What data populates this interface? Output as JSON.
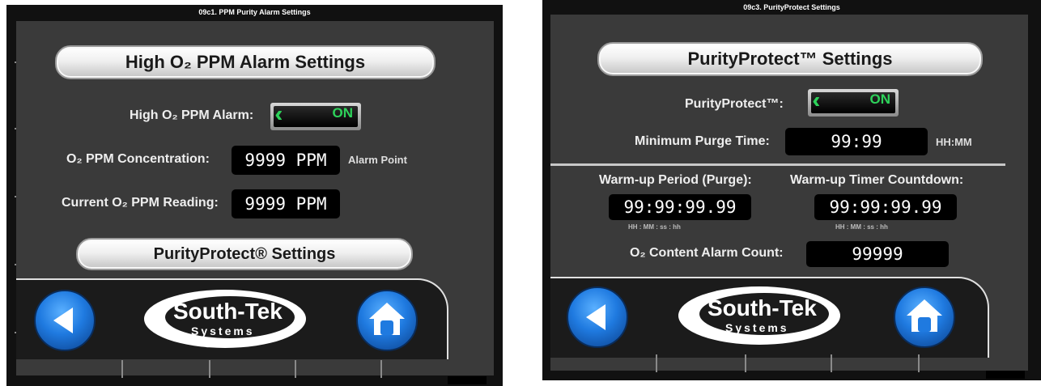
{
  "panel1": {
    "title": "09c1. PPM Purity Alarm Settings",
    "header": "High O₂ PPM Alarm Settings",
    "alarm_label": "High O₂ PPM Alarm:",
    "alarm_state": "ON",
    "concentration_label": "O₂ PPM Concentration:",
    "concentration_value": "9999 PPM",
    "concentration_note": "Alarm Point",
    "reading_label": "Current O₂ PPM Reading:",
    "reading_value": "9999 PPM",
    "purity_button": "PurityProtect® Settings"
  },
  "panel2": {
    "title": "09c3. PurityProtect Settings",
    "header": "PurityProtect™ Settings",
    "protect_label": "PurityProtect™:",
    "protect_state": "ON",
    "purge_label": "Minimum Purge Time:",
    "purge_value": "99:99",
    "purge_unit": "HH:MM",
    "warmup_label": "Warm-up Period (Purge):",
    "warmup_value": "99:99:99.99",
    "warmup_units": "HH  :  MM  :  ss  :  hh",
    "countdown_label": "Warm-up Timer Countdown:",
    "countdown_value": "99:99:99.99",
    "countdown_units": "HH  :  MM  :  ss  :  hh",
    "count_label": "O₂ Content Alarm Count:",
    "count_value": "99999"
  },
  "logo": {
    "line1": "South-Tek",
    "line2": "Systems"
  },
  "icons": {
    "back": "back-arrow-icon",
    "home": "home-icon"
  },
  "colors": {
    "accent_green": "#2dd35a",
    "button_blue": "#1f7ae0"
  }
}
